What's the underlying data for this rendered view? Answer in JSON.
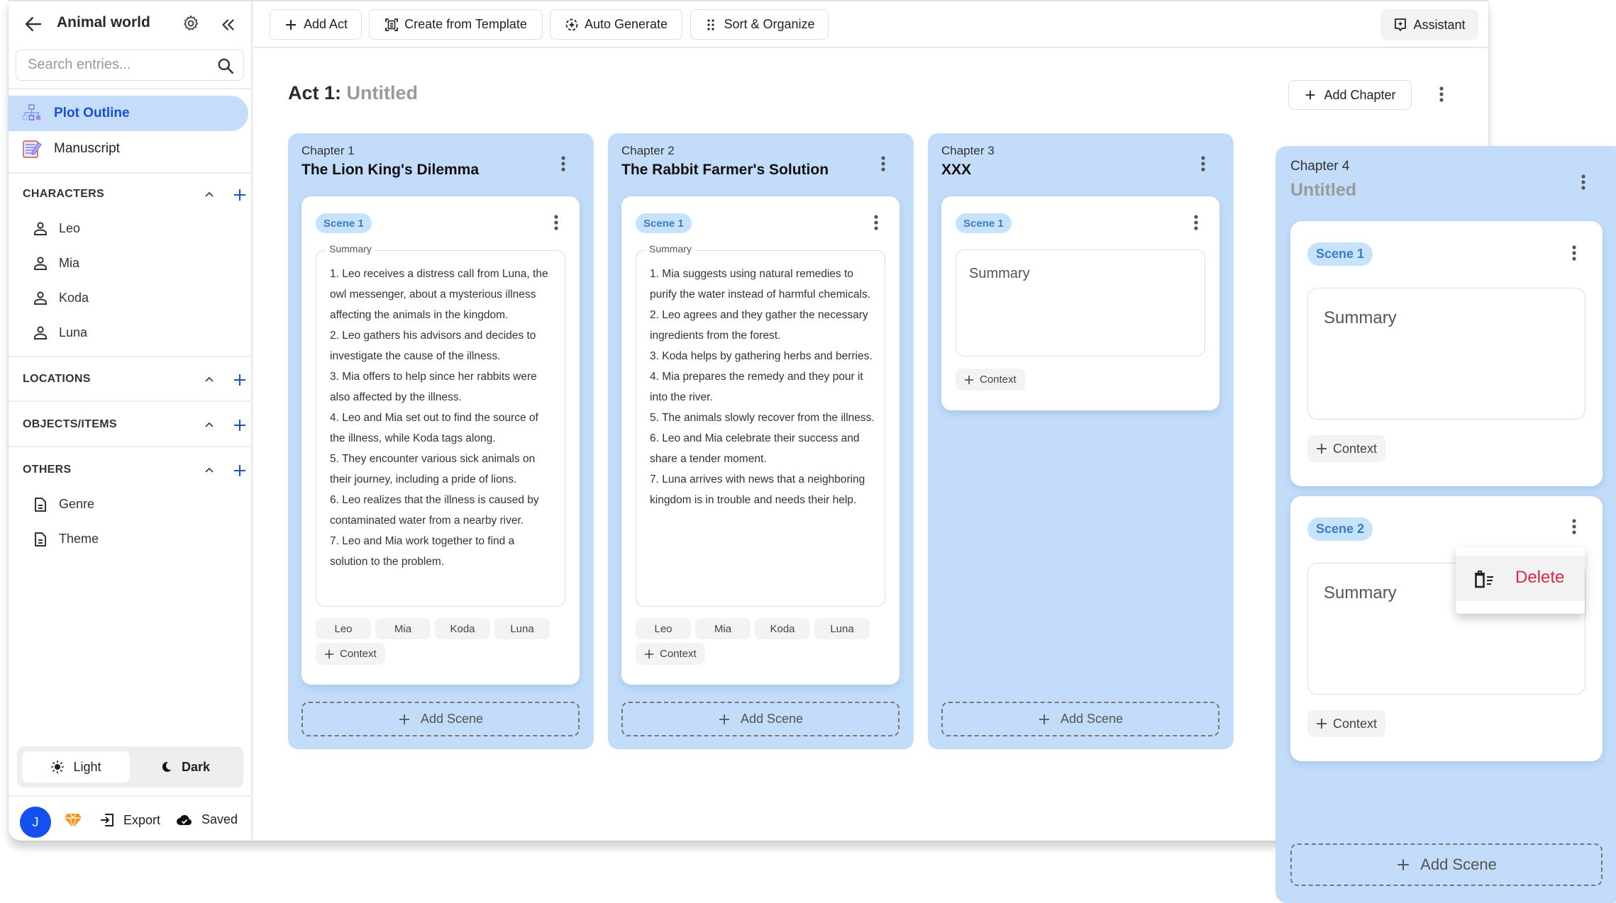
{
  "sidebar": {
    "title": "Animal world",
    "search_placeholder": "Search entries...",
    "nav": [
      {
        "label": "Plot Outline",
        "icon": "plot-outline-icon",
        "active": true
      },
      {
        "label": "Manuscript",
        "icon": "manuscript-icon",
        "active": false
      }
    ],
    "sections": [
      {
        "label": "CHARACTERS",
        "entries": [
          "Leo",
          "Mia",
          "Koda",
          "Luna"
        ],
        "entry_icon": "person-icon"
      },
      {
        "label": "LOCATIONS",
        "entries": []
      },
      {
        "label": "OBJECTS/ITEMS",
        "entries": []
      },
      {
        "label": "OTHERS",
        "entries": [
          "Genre",
          "Theme"
        ],
        "entry_icon": "document-icon"
      }
    ],
    "theme": {
      "light": "Light",
      "dark": "Dark",
      "selected": "Light"
    },
    "footer": {
      "avatar_initial": "J",
      "export": "Export",
      "saved": "Saved"
    }
  },
  "toolbar": {
    "add_act": "Add Act",
    "create_from_template": "Create from Template",
    "auto_generate": "Auto Generate",
    "sort_organize": "Sort & Organize",
    "assistant": "Assistant"
  },
  "act": {
    "prefix": "Act 1:",
    "name": "Untitled",
    "add_chapter": "Add Chapter"
  },
  "chapters": [
    {
      "number": "Chapter 1",
      "title": "The Lion King's Dilemma",
      "scenes": [
        {
          "badge": "Scene 1",
          "summary_label": "Summary",
          "summary": "1. Leo receives a distress call from Luna, the owl messenger, about a mysterious illness affecting the animals in the kingdom.\n2. Leo gathers his advisors and decides to investigate the cause of the illness.\n3. Mia offers to help since her rabbits were also affected by the illness.\n4. Leo and Mia set out to find the source of the illness, while Koda tags along.\n5. They encounter various sick animals on their journey, including a pride of lions.\n6. Leo realizes that the illness is caused by contaminated water from a nearby river.\n7. Leo and Mia work together to find a solution to the problem.",
          "tags": [
            "Leo",
            "Mia",
            "Koda",
            "Luna"
          ],
          "context": "Context"
        }
      ],
      "add_scene": "Add Scene"
    },
    {
      "number": "Chapter 2",
      "title": "The Rabbit Farmer's Solution",
      "scenes": [
        {
          "badge": "Scene 1",
          "summary_label": "Summary",
          "summary": "1. Mia suggests using natural remedies to purify the water instead of harmful chemicals.\n2. Leo agrees and they gather the necessary ingredients from the forest.\n3. Koda helps by gathering herbs and berries.\n4. Mia prepares the remedy and they pour it into the river.\n5. The animals slowly recover from the illness.\n6. Leo and Mia celebrate their success and share a tender moment.\n7. Luna arrives with news that a neighboring kingdom is in trouble and needs their help.",
          "tags": [
            "Leo",
            "Mia",
            "Koda",
            "Luna"
          ],
          "context": "Context"
        }
      ],
      "add_scene": "Add Scene"
    },
    {
      "number": "Chapter 3",
      "title": "XXX",
      "scenes": [
        {
          "badge": "Scene 1",
          "summary_placeholder": "Summary",
          "context": "Context"
        }
      ],
      "add_scene": "Add Scene"
    },
    {
      "number": "Chapter 4",
      "title": "Untitled",
      "scenes": [
        {
          "badge": "Scene 1",
          "summary_placeholder": "Summary",
          "context": "Context"
        },
        {
          "badge": "Scene 2",
          "summary_placeholder": "Summary",
          "context": "Context"
        }
      ],
      "add_scene": "Add Scene"
    }
  ],
  "context_menu": {
    "items": [
      {
        "label": "Delete",
        "icon": "delete-icon",
        "color": "#d22a45"
      }
    ]
  },
  "colors": {
    "accent": "#1a4fd6",
    "chapter_bg": "#c2dcfa",
    "scene_badge_bg": "#c7e3fb",
    "scene_badge_text": "#3b7cc4",
    "avatar_bg": "#1450ef",
    "delete": "#d22a45"
  }
}
